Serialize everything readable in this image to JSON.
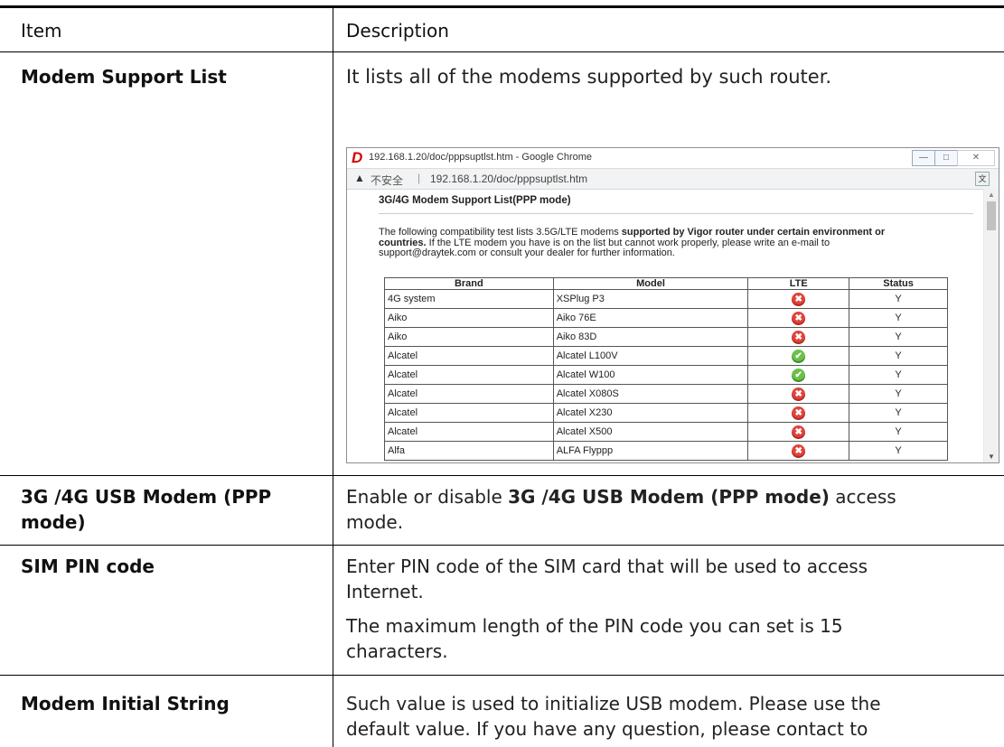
{
  "header": {
    "item": "Item",
    "description": "Description"
  },
  "rows": [
    {
      "item": "Modem Support List",
      "description": "It lists all of the modems supported by such router."
    },
    {
      "item_line1": "3G /4G USB Modem (PPP",
      "item_line2": "mode)",
      "desc_pre": "Enable or disable ",
      "desc_bold": "3G /4G USB Modem (PPP mode)",
      "desc_post": " access",
      "desc_line2": "mode."
    },
    {
      "item": "SIM PIN code",
      "desc1_line1": "Enter PIN code of the SIM card that will be used to access",
      "desc1_line2": "Internet.",
      "desc2_line1": "The maximum length of the PIN code you can set is 15",
      "desc2_line2": "characters."
    },
    {
      "item": "Modem Initial String",
      "desc_line1": "Such value is used to initialize USB modem. Please use the",
      "desc_line2": "default value. If you have any question, please contact to"
    }
  ],
  "browser": {
    "window_title": "192.168.1.20/doc/pppsuptlst.htm - Google Chrome",
    "insecure_label": "不安全",
    "url": "192.168.1.20/doc/pppsuptlst.htm",
    "page_title": "3G/4G Modem Support List(PPP mode)",
    "intro_pre": "The following compatibility test lists 3.5G/LTE modems ",
    "intro_bold1": "supported by Vigor router under certain environment or",
    "intro_bold2": "countries.",
    "intro_post": " If the LTE modem you have is on the list but cannot work properly, please write an e-mail to",
    "intro_line3": "support@draytek.com or consult your dealer for further information.",
    "table": {
      "columns": [
        "Brand",
        "Model",
        "LTE",
        "Status"
      ],
      "rows": [
        {
          "brand": "4G system",
          "model": "XSPlug P3",
          "lte": "no",
          "status": "Y"
        },
        {
          "brand": "Aiko",
          "model": "Aiko 76E",
          "lte": "no",
          "status": "Y"
        },
        {
          "brand": "Aiko",
          "model": "Aiko 83D",
          "lte": "no",
          "status": "Y"
        },
        {
          "brand": "Alcatel",
          "model": "Alcatel L100V",
          "lte": "yes",
          "status": "Y"
        },
        {
          "brand": "Alcatel",
          "model": "Alcatel W100",
          "lte": "yes",
          "status": "Y"
        },
        {
          "brand": "Alcatel",
          "model": "Alcatel X080S",
          "lte": "no",
          "status": "Y"
        },
        {
          "brand": "Alcatel",
          "model": "Alcatel X230",
          "lte": "no",
          "status": "Y"
        },
        {
          "brand": "Alcatel",
          "model": "Alcatel X500",
          "lte": "no",
          "status": "Y"
        },
        {
          "brand": "Alfa",
          "model": "ALFA Flyppp",
          "lte": "no",
          "status": "Y"
        }
      ]
    }
  }
}
